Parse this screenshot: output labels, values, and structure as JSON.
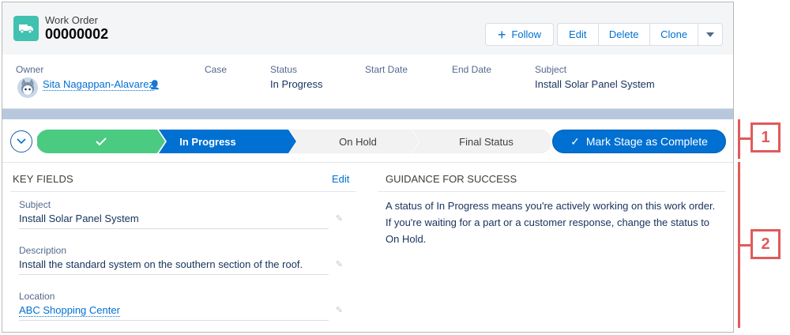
{
  "header": {
    "object_type": "Work Order",
    "record_name": "00000002",
    "follow_label": "Follow",
    "edit_label": "Edit",
    "delete_label": "Delete",
    "clone_label": "Clone"
  },
  "highlights": {
    "owner_label": "Owner",
    "owner_value": "Sita Nagappan-Alavarez",
    "case_label": "Case",
    "status_label": "Status",
    "status_value": "In Progress",
    "start_label": "Start Date",
    "end_label": "End Date",
    "subject_label": "Subject",
    "subject_value": "Install Solar Panel System"
  },
  "path": {
    "stages": [
      {
        "label": "",
        "state": "complete"
      },
      {
        "label": "In Progress",
        "state": "current"
      },
      {
        "label": "On Hold",
        "state": "incomplete"
      },
      {
        "label": "Final Status",
        "state": "incomplete"
      }
    ],
    "mark_complete_label": "Mark Stage as Complete",
    "colors": {
      "complete": "#4bca81",
      "current": "#0070d2",
      "incomplete": "#f3f2f2"
    }
  },
  "key_fields": {
    "title": "KEY FIELDS",
    "edit_label": "Edit",
    "fields": [
      {
        "label": "Subject",
        "value": "Install Solar Panel System"
      },
      {
        "label": "Description",
        "value": "Install the standard system on the southern section of the roof."
      },
      {
        "label": "Location",
        "value": "ABC Shopping Center"
      }
    ]
  },
  "guidance": {
    "title": "GUIDANCE FOR SUCCESS",
    "text": "A status of In Progress means you're actively working on this work order. If you're waiting for a part or a customer response, change the status to On Hold."
  },
  "callouts": [
    "1",
    "2"
  ]
}
